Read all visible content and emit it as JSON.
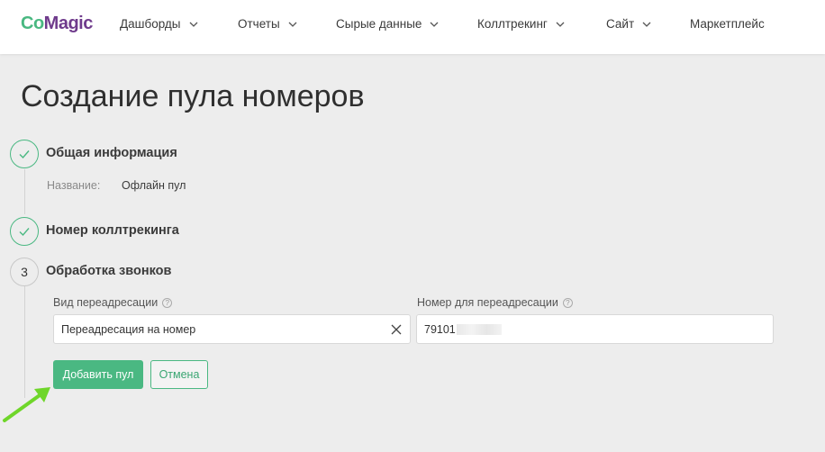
{
  "logo": {
    "part1": "Co",
    "part2": "Magic"
  },
  "nav": [
    {
      "label": "Дашборды"
    },
    {
      "label": "Отчеты"
    },
    {
      "label": "Сырые данные"
    },
    {
      "label": "Коллтрекинг"
    },
    {
      "label": "Сайт"
    },
    {
      "label": "Маркетплейс"
    }
  ],
  "page": {
    "title": "Создание пула номеров"
  },
  "steps": [
    {
      "title": "Общая информация",
      "status": "done"
    },
    {
      "title": "Номер коллтрекинга",
      "status": "done"
    },
    {
      "number": "3",
      "title": "Обработка звонков",
      "status": "active"
    }
  ],
  "general": {
    "name_label": "Название:",
    "name_value": "Офлайн пул"
  },
  "form": {
    "redirect_type_label": "Вид переадресации",
    "redirect_type_value": "Переадресация на номер",
    "redirect_number_label": "Номер для переадресации",
    "redirect_number_value": "79101",
    "help_glyph": "?"
  },
  "buttons": {
    "add": "Добавить пул",
    "cancel": "Отмена"
  },
  "colors": {
    "accent": "#4ab882",
    "logo_purple": "#6f3b8c",
    "arrow": "#6fd62a"
  },
  "icons": {
    "check": "check-icon",
    "chevron": "chevron-down-icon",
    "clear": "close-icon",
    "help": "question-circle-icon"
  }
}
